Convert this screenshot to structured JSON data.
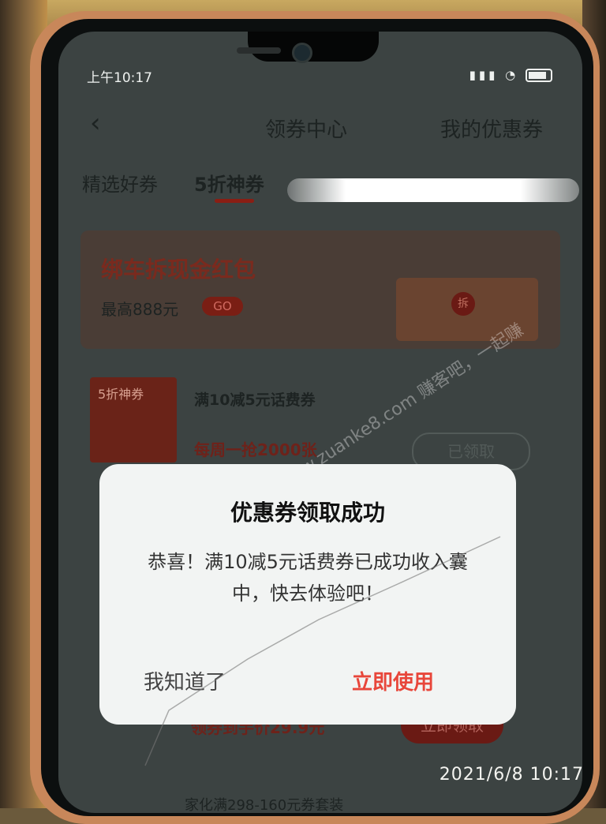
{
  "status": {
    "time": "上午10:17"
  },
  "nav": {
    "back": "‹",
    "title": "领券中心",
    "my_coupons": "我的优惠券"
  },
  "tabs": [
    {
      "label": "精选好券"
    },
    {
      "label": "5折神券"
    }
  ],
  "banner": {
    "title": "绑车拆现金红包",
    "subtitle": "最高888元",
    "go": "GO",
    "gift_tag": "拆"
  },
  "coupon": {
    "image_label": "5折神券",
    "title": "满10减5元话费券",
    "limit": "每周一抢2000张",
    "status": "已领取"
  },
  "dialog": {
    "title": "优惠券领取成功",
    "body": "恭喜！满10减5元话费券已成功收入囊中，快去体验吧！",
    "cancel": "我知道了",
    "confirm": "立即使用"
  },
  "below": {
    "price_text": "领券到手价29.9元",
    "button": "立即领取",
    "next_item": "家化满298-160元券套装"
  },
  "watermark": "www.zuanke8.com 赚客吧，一起赚",
  "photo_timestamp": "2021/6/8  10:17"
}
